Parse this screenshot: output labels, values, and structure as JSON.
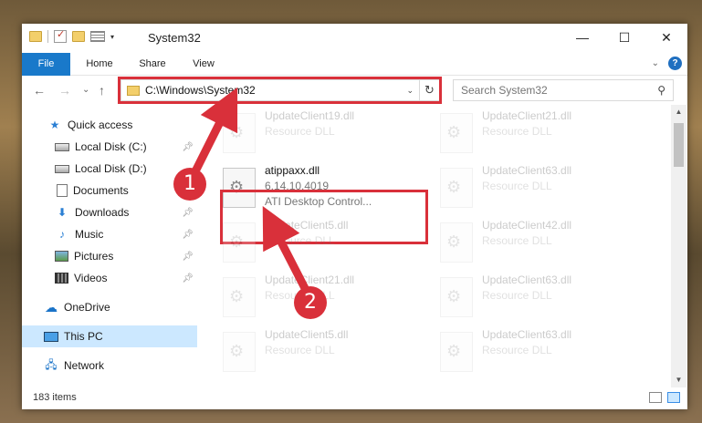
{
  "window": {
    "title": "System32",
    "controls": {
      "minimize": "—",
      "maximize": "☐",
      "close": "✕"
    }
  },
  "ribbon": {
    "tabs": [
      {
        "label": "File",
        "active": true
      },
      {
        "label": "Home"
      },
      {
        "label": "Share"
      },
      {
        "label": "View"
      }
    ],
    "help_label": "?"
  },
  "nav": {
    "back": "←",
    "forward": "→",
    "recent": "⌄",
    "up": "↑",
    "address": "C:\\Windows\\System32",
    "address_dropdown": "⌄",
    "refresh": "↻",
    "search_placeholder": "Search System32"
  },
  "sidebar": {
    "items": [
      {
        "label": "Quick access",
        "icon": "star-icon",
        "pinned": false
      },
      {
        "label": "Local Disk (C:)",
        "icon": "drive-icon",
        "pinned": true
      },
      {
        "label": "Local Disk (D:)",
        "icon": "drive-icon",
        "pinned": false
      },
      {
        "label": "Documents",
        "icon": "document-icon",
        "pinned": true
      },
      {
        "label": "Downloads",
        "icon": "download-icon",
        "pinned": true
      },
      {
        "label": "Music",
        "icon": "music-icon",
        "pinned": true
      },
      {
        "label": "Pictures",
        "icon": "pictures-icon",
        "pinned": true
      },
      {
        "label": "Videos",
        "icon": "videos-icon",
        "pinned": true
      },
      {
        "label": "OneDrive",
        "icon": "onedrive-icon",
        "pinned": false
      },
      {
        "label": "This PC",
        "icon": "pc-icon",
        "pinned": false,
        "selected": true
      },
      {
        "label": "Network",
        "icon": "network-icon",
        "pinned": false
      }
    ]
  },
  "files": {
    "highlighted": {
      "name": "atippaxx.dll",
      "version": "6.14.10.4019",
      "description": "ATI Desktop Control..."
    },
    "faded": [
      {
        "name": "UpdateClient19.dll",
        "description": "Resource DLL"
      },
      {
        "name": "UpdateClient21.dll",
        "description": "Resource DLL"
      },
      {
        "name": "UpdateClient63.dll",
        "description": "Resource DLL"
      },
      {
        "name": "UpdateClient5.dll",
        "description": "Resource DLL"
      },
      {
        "name": "UpdateClient42.dll",
        "description": "Resource DLL"
      },
      {
        "name": "UpdateClient21.dll",
        "description": "Resource DLL"
      },
      {
        "name": "UpdateClient63.dll",
        "description": "Resource DLL"
      },
      {
        "name": "UpdateClient5.dll",
        "description": "Resource DLL"
      },
      {
        "name": "UpdateClient63.dll",
        "description": "Resource DLL"
      }
    ]
  },
  "status": {
    "item_count": "183 items"
  },
  "annotations": {
    "step1": "1",
    "step2": "2",
    "color": "#d9303a"
  }
}
